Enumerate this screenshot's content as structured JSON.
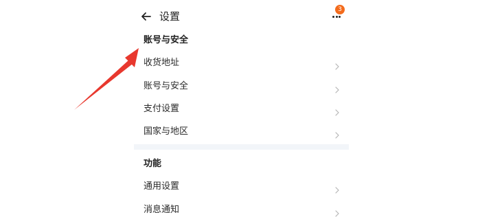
{
  "header": {
    "title": "设置",
    "back_icon": "arrow-left-icon",
    "more_icon": "more-dots-icon",
    "notification_count": "3"
  },
  "sections": [
    {
      "title": "账号与安全",
      "items": [
        {
          "label": "收货地址",
          "icon": "chevron-right-icon"
        },
        {
          "label": "账号与安全",
          "icon": "chevron-right-icon"
        },
        {
          "label": "支付设置",
          "icon": "chevron-right-icon"
        },
        {
          "label": "国家与地区",
          "icon": "chevron-right-icon"
        }
      ]
    },
    {
      "title": "功能",
      "items": [
        {
          "label": "通用设置",
          "icon": "chevron-right-icon"
        },
        {
          "label": "消息通知",
          "icon": "chevron-right-icon"
        }
      ]
    }
  ],
  "colors": {
    "badge": "#f36b1c",
    "divider": "#f2f5f9",
    "annotation_arrow": "#e8382e",
    "chevron": "#b5b5b5"
  }
}
